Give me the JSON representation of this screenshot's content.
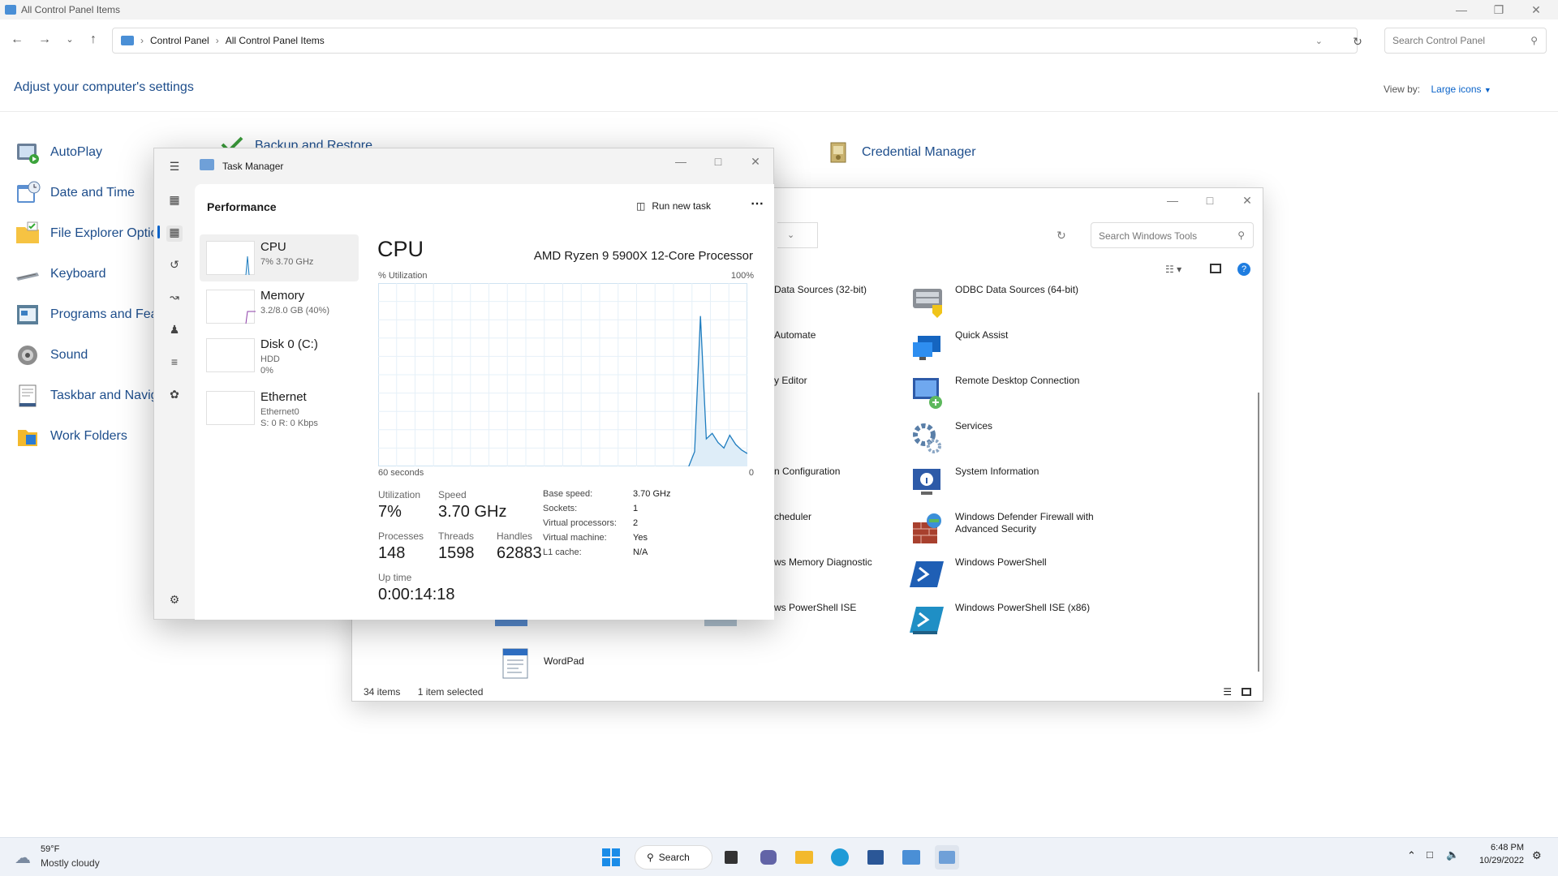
{
  "control_panel": {
    "title": "All Control Panel Items",
    "breadcrumb": [
      "Control Panel",
      "All Control Panel Items"
    ],
    "search_placeholder": "Search Control Panel",
    "heading": "Adjust your computer's settings",
    "view_by_label": "View by:",
    "view_by_value": "Large icons",
    "items": [
      {
        "label": "AutoPlay",
        "icon": "autoplay-icon"
      },
      {
        "label": "Date and Time",
        "icon": "date-time-icon"
      },
      {
        "label": "File Explorer Optio",
        "icon": "folder-options-icon"
      },
      {
        "label": "Keyboard",
        "icon": "keyboard-icon"
      },
      {
        "label": "Programs and Feat",
        "icon": "programs-icon"
      },
      {
        "label": "Sound",
        "icon": "sound-icon"
      },
      {
        "label": "Taskbar and Navig",
        "icon": "taskbar-icon"
      },
      {
        "label": "Work Folders",
        "icon": "work-folders-icon"
      },
      {
        "label": "Backup and Restore",
        "icon": "backup-icon"
      },
      {
        "label": "Credential Manager",
        "icon": "credential-manager-icon"
      }
    ]
  },
  "windows_tools": {
    "search_placeholder": "Search Windows Tools",
    "items_left": [
      {
        "label": "Data Sources (32-bit)"
      },
      {
        "label": "Automate"
      },
      {
        "label": "y Editor"
      },
      {
        "label": "n Configuration"
      },
      {
        "label": "cheduler"
      },
      {
        "label": "ws Memory Diagnostic"
      },
      {
        "label": "ws PowerShell ISE"
      }
    ],
    "items_right": [
      {
        "label": "ODBC Data Sources (64-bit)",
        "icon": "odbc-icon"
      },
      {
        "label": "Quick Assist",
        "icon": "quick-assist-icon"
      },
      {
        "label": "Remote Desktop Connection",
        "icon": "remote-desktop-icon"
      },
      {
        "label": "Services",
        "icon": "services-icon"
      },
      {
        "label": "System Information",
        "icon": "system-info-icon"
      },
      {
        "label": "Windows Defender Firewall with Advanced Security",
        "icon": "firewall-icon"
      },
      {
        "label": "Windows PowerShell",
        "icon": "powershell-icon"
      },
      {
        "label": "Windows PowerShell ISE (x86)",
        "icon": "powershell-ise-icon"
      }
    ],
    "wordpad": "WordPad",
    "status_items": "34 items",
    "status_selected": "1 item selected"
  },
  "task_manager": {
    "title": "Task Manager",
    "section": "Performance",
    "run_new_task": "Run new task",
    "list": [
      {
        "name": "CPU",
        "sub1": "7% 3.70 GHz",
        "sub2": ""
      },
      {
        "name": "Memory",
        "sub1": "3.2/8.0 GB (40%)",
        "sub2": ""
      },
      {
        "name": "Disk 0 (C:)",
        "sub1": "HDD",
        "sub2": "0%"
      },
      {
        "name": "Ethernet",
        "sub1": "Ethernet0",
        "sub2": "S: 0 R: 0 Kbps"
      }
    ],
    "cpu": {
      "heading": "CPU",
      "model": "AMD Ryzen 9 5900X 12-Core Processor",
      "util_label": "% Utilization",
      "max_label": "100%",
      "time_label": "60 seconds",
      "min_label": "0",
      "utilization_label": "Utilization",
      "utilization": "7%",
      "speed_label": "Speed",
      "speed": "3.70 GHz",
      "processes_label": "Processes",
      "processes": "148",
      "threads_label": "Threads",
      "threads": "1598",
      "handles_label": "Handles",
      "handles": "62883",
      "uptime_label": "Up time",
      "uptime": "0:00:14:18",
      "details": [
        {
          "k": "Base speed:",
          "v": "3.70 GHz"
        },
        {
          "k": "Sockets:",
          "v": "1"
        },
        {
          "k": "Virtual processors:",
          "v": "2"
        },
        {
          "k": "Virtual machine:",
          "v": "Yes"
        },
        {
          "k": "L1 cache:",
          "v": "N/A"
        }
      ]
    }
  },
  "chart_data": {
    "type": "line",
    "title": "",
    "xlabel": "60 seconds",
    "ylabel": "% Utilization",
    "xlim": [
      60,
      0
    ],
    "ylim": [
      0,
      100
    ],
    "grid": true,
    "series": [
      {
        "values": [
          0,
          0,
          0,
          0,
          0,
          0,
          0,
          0,
          0,
          0,
          0,
          0,
          0,
          0,
          0,
          0,
          0,
          0,
          0,
          0,
          0,
          0,
          0,
          0,
          0,
          0,
          0,
          0,
          0,
          0,
          0,
          0,
          0,
          0,
          0,
          0,
          0,
          0,
          0,
          0,
          0,
          0,
          0,
          0,
          0,
          0,
          0,
          0,
          0,
          0,
          0,
          0,
          0,
          0,
          8,
          82,
          15,
          18,
          13,
          10,
          17,
          12,
          9,
          7
        ]
      }
    ]
  },
  "taskbar": {
    "weather_temp": "59°F",
    "weather_desc": "Mostly cloudy",
    "search": "Search",
    "time": "6:48 PM",
    "date": "10/29/2022"
  },
  "colors": {
    "accent": "#0a63c9",
    "chart_line": "#1f7dbf",
    "chart_fill": "#deedf8"
  }
}
